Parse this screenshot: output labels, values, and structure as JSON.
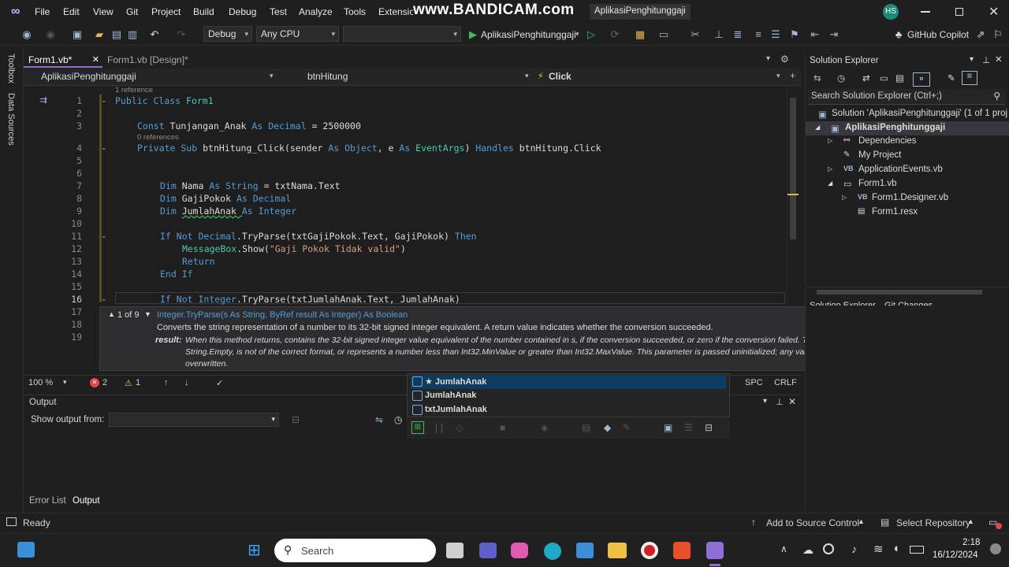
{
  "menu": [
    "File",
    "Edit",
    "View",
    "Git",
    "Project",
    "Build",
    "Debug",
    "Test",
    "Analyze",
    "Tools",
    "Extensions"
  ],
  "watermark": "www.BANDICAM.com",
  "solution_title": "AplikasiPenghitunggaji",
  "user_initials": "HS",
  "toolbar": {
    "config": "Debug",
    "platform": "Any CPU",
    "startup": "AplikasiPenghitunggaji",
    "copilot": "GitHub Copilot"
  },
  "left_rail": [
    "Toolbox",
    "Data Sources"
  ],
  "tabs": [
    {
      "label": "Form1.vb*"
    },
    {
      "label": "Form1.vb [Design]*"
    }
  ],
  "nav": {
    "project": "AplikasiPenghitunggaji",
    "object": "btnHitung",
    "event": "Click"
  },
  "code_lines": [
    {
      "n": "1",
      "ref": "1 reference"
    },
    {
      "n": "2"
    },
    {
      "n": "3"
    },
    {
      "n": "4",
      "ref": "0 references"
    },
    {
      "n": "5"
    },
    {
      "n": "6"
    },
    {
      "n": "7"
    },
    {
      "n": "8"
    },
    {
      "n": "9"
    },
    {
      "n": "10"
    },
    {
      "n": "11"
    },
    {
      "n": "12"
    },
    {
      "n": "13"
    },
    {
      "n": "14"
    },
    {
      "n": "15"
    },
    {
      "n": "16"
    },
    {
      "n": "17"
    },
    {
      "n": "18"
    },
    {
      "n": "19"
    }
  ],
  "code": {
    "l1a": "Public Class ",
    "l1b": "Form1",
    "l3a": "Const ",
    "l3b": "Tunjangan_Anak ",
    "l3c": "As ",
    "l3d": "Decimal ",
    "l3e": "= 2500000",
    "l4a": "Private Sub ",
    "l4b": "btnHitung_Click(sender ",
    "l4c": "As ",
    "l4d": "Object",
    "l4e": ", e ",
    "l4f": "As ",
    "l4g": "EventArgs",
    "l4h": ") ",
    "l4i": "Handles ",
    "l4j": "btnHitung.Click",
    "l7a": "Dim ",
    "l7b": "Nama ",
    "l7c": "As ",
    "l7d": "String ",
    "l7e": "= txtNama.Text",
    "l8a": "Dim ",
    "l8b": "GajiPokok ",
    "l8c": "As ",
    "l8d": "Decimal",
    "l9a": "Dim ",
    "l9b": "JumlahAnak ",
    "l9c": "As ",
    "l9d": "Integer",
    "l11a": "If Not ",
    "l11b": "Decimal",
    "l11c": ".TryParse(txtGajiPokok.Text, GajiPokok) ",
    "l11d": "Then",
    "l12a": "MessageBox",
    "l12b": ".Show(",
    "l12c": "\"Gaji Pokok Tidak valid\"",
    "l12d": ")",
    "l13a": "Return",
    "l14a": "End If",
    "l16a": "If Not ",
    "l16b": "Integer",
    "l16c": ".TryParse(txtJumlahAnak.Text, JumlahAnak)"
  },
  "tooltip": {
    "counter": "1 of 9",
    "sig": "Integer.TryParse(s As String, ByRef result As Integer) As Boolean",
    "desc": "Converts the string representation of a number to its 32-bit signed integer equivalent. A return value indicates whether the conversion succeeded.",
    "param": "result:",
    "param_desc1": "When this method returns, contains the 32-bit signed integer value equivalent of the number contained in s, if the conversion succeeded, or zero if the conversion failed. The conversion fails if the s parameter is null or",
    "param_desc2": "String.Empty, is not of the correct format, or represents a number less than Int32.MinValue or greater than Int32.MaxValue. This parameter is passed uninitialized; any value originally supplied in result will be",
    "param_desc3": "overwritten."
  },
  "editor_status": {
    "zoom": "100 %",
    "errors": "2",
    "warnings": "1",
    "spc": "SPC",
    "crlf": "CRLF"
  },
  "completion": [
    {
      "label": "★ JumlahAnak"
    },
    {
      "label": "JumlahAnak"
    },
    {
      "label": "txtJumlahAnak"
    }
  ],
  "output": {
    "title": "Output",
    "show_from": "Show output from:"
  },
  "bottom_tabs": [
    "Error List",
    "Output"
  ],
  "solution_explorer": {
    "title": "Solution Explorer",
    "search": "Search Solution Explorer (Ctrl+;)",
    "solution": "Solution 'AplikasiPenghitunggaji' (1 of 1 proj",
    "project": "AplikasiPenghitunggaji",
    "items": [
      "Dependencies",
      "My Project",
      "ApplicationEvents.vb",
      "Form1.vb",
      "Form1.Designer.vb",
      "Form1.resx"
    ],
    "bottom_tabs": [
      "Solution Explorer",
      "Git Changes"
    ]
  },
  "status": {
    "ready": "Ready",
    "source_control": "Add to Source Control",
    "repo": "Select Repository"
  },
  "taskbar": {
    "search": "Search",
    "time": "2:18",
    "date": "16/12/2024"
  }
}
